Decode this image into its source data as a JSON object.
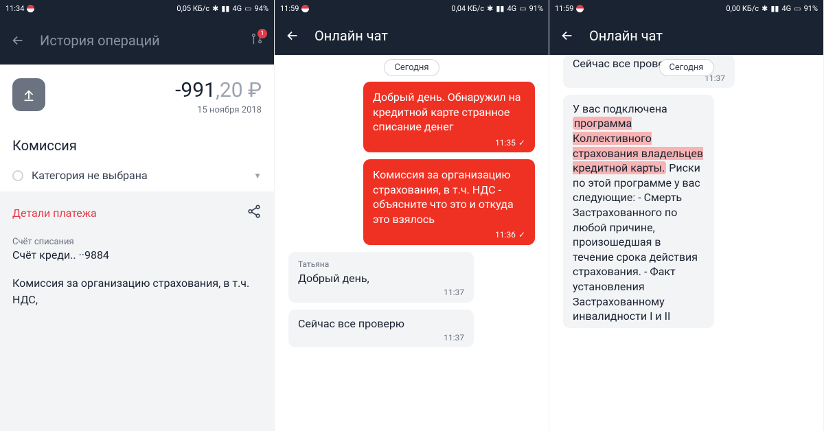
{
  "pane1": {
    "status": {
      "time": "11:34",
      "speed": "0,05 КБ/с",
      "net": "4G",
      "batt": "94%"
    },
    "header": {
      "title": "История операций",
      "badge": "1"
    },
    "amount_int": "-991",
    "amount_dec": ",20 ₽",
    "date": "15 ноября 2018",
    "section": "Комиссия",
    "category": "Категория не выбрана",
    "details_label": "Детали платежа",
    "acct_label": "Счёт списания",
    "acct_value": "Счёт креди.. ··9884",
    "desc": "Комиссия за организацию страхования, в т.ч. НДС,"
  },
  "pane2": {
    "status": {
      "time": "11:59",
      "speed": "0,04 КБ/с",
      "net": "4G",
      "batt": "91%"
    },
    "title": "Онлайн чат",
    "date_pill": "Сегодня",
    "m1": {
      "text": "Добрый день. Обнаружил на кредитной карте странное списание денег",
      "time": "11:35"
    },
    "m2": {
      "text": "Комиссия за организацию страхования, в т.ч. НДС - объясните что это и откуда это взялось",
      "time": "11:36"
    },
    "m3": {
      "author": "Татьяна",
      "text": "Добрый день,",
      "time": "11:37"
    },
    "m4": {
      "text": "Сейчас все проверю",
      "time": "11:37"
    }
  },
  "pane3": {
    "status": {
      "time": "11:59",
      "speed": "0,00 КБ/с",
      "net": "4G",
      "batt": "91%"
    },
    "title": "Онлайн чат",
    "date_pill": "Сегодня",
    "m0": {
      "text": "Сейчас все проверю",
      "time": "11:37"
    },
    "m1": {
      "pre": "У вас подключена ",
      "hl": "программа Коллективного страхования владельцев кредитной карты.",
      "post": " Риски по этой программе у вас следующие: - Смерть Застрахованного по любой причине, произошедшая в течение срока действия страхования. - Факт установления Застрахованному инвалидности I и II"
    }
  }
}
